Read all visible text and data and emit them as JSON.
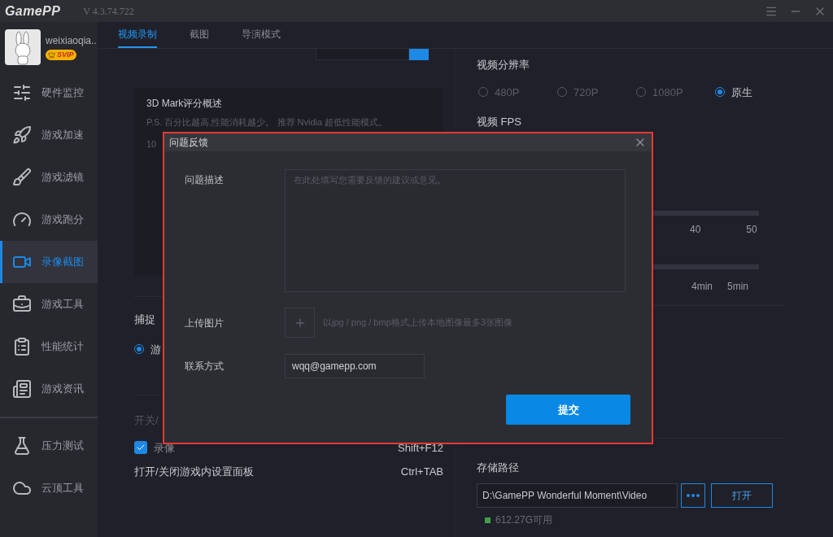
{
  "app": {
    "logo": "GamePP",
    "version": "V 4.3.74.722"
  },
  "user": {
    "name": "weixiaoqia..",
    "badge": "SVIP"
  },
  "sidebar": {
    "items": [
      {
        "label": "硬件监控",
        "selected": false
      },
      {
        "label": "游戏加速",
        "selected": false
      },
      {
        "label": "游戏滤镜",
        "selected": false
      },
      {
        "label": "游戏跑分",
        "selected": false
      },
      {
        "label": "录像截图",
        "selected": true
      },
      {
        "label": "游戏工具",
        "selected": false
      },
      {
        "label": "性能统计",
        "selected": false
      },
      {
        "label": "游戏资讯",
        "selected": false
      }
    ],
    "bottom_items": [
      {
        "label": "压力测试",
        "selected": false
      },
      {
        "label": "云顶工具",
        "selected": false
      }
    ]
  },
  "tabs": [
    {
      "label": "视频录制",
      "selected": true
    },
    {
      "label": "截图",
      "selected": false
    },
    {
      "label": "导演模式",
      "selected": false
    }
  ],
  "benchmark": {
    "title": "3D Mark评分概述",
    "note": "P.S. 百分比越高,性能消耗越少。 推荐 Nvidia 超低性能模式。",
    "axis_label": "10"
  },
  "capture": {
    "title": "捕捉",
    "option": {
      "label": "游",
      "selected": true
    }
  },
  "hotkeys": {
    "title": "开关/",
    "rows": [
      {
        "kind": "checkbox",
        "label": "录像",
        "checked": true,
        "key": "Shift+F12"
      },
      {
        "kind": "plain",
        "label": "打开/关闭游戏内设置面板",
        "key": "Ctrl+TAB"
      }
    ]
  },
  "resolution": {
    "title": "视频分辨率",
    "options": [
      {
        "label": "480P",
        "selected": false
      },
      {
        "label": "720P",
        "selected": false
      },
      {
        "label": "1080P",
        "selected": false
      },
      {
        "label": "原生",
        "selected": true
      }
    ]
  },
  "fps": {
    "title": "视频 FPS",
    "ticks": [
      "40",
      "50"
    ]
  },
  "duration": {
    "ticks": [
      "4min",
      "5min"
    ]
  },
  "storage": {
    "title": "存储路径",
    "path": "D:\\GamePP Wonderful Moment\\Video",
    "open": "打开",
    "free": "612.27G可用"
  },
  "dialog": {
    "title": "问题反馈",
    "fields": [
      {
        "kind": "textarea",
        "label": "问题描述",
        "placeholder": "在此处填写您需要反馈的建议或意见。"
      },
      {
        "kind": "upload",
        "label": "上传图片",
        "hint": "以jpg / png / bmp格式上传本地图像最多3张图像"
      },
      {
        "kind": "input",
        "label": "联系方式",
        "value": "wqq@gamepp.com"
      }
    ],
    "submit": "提交"
  }
}
